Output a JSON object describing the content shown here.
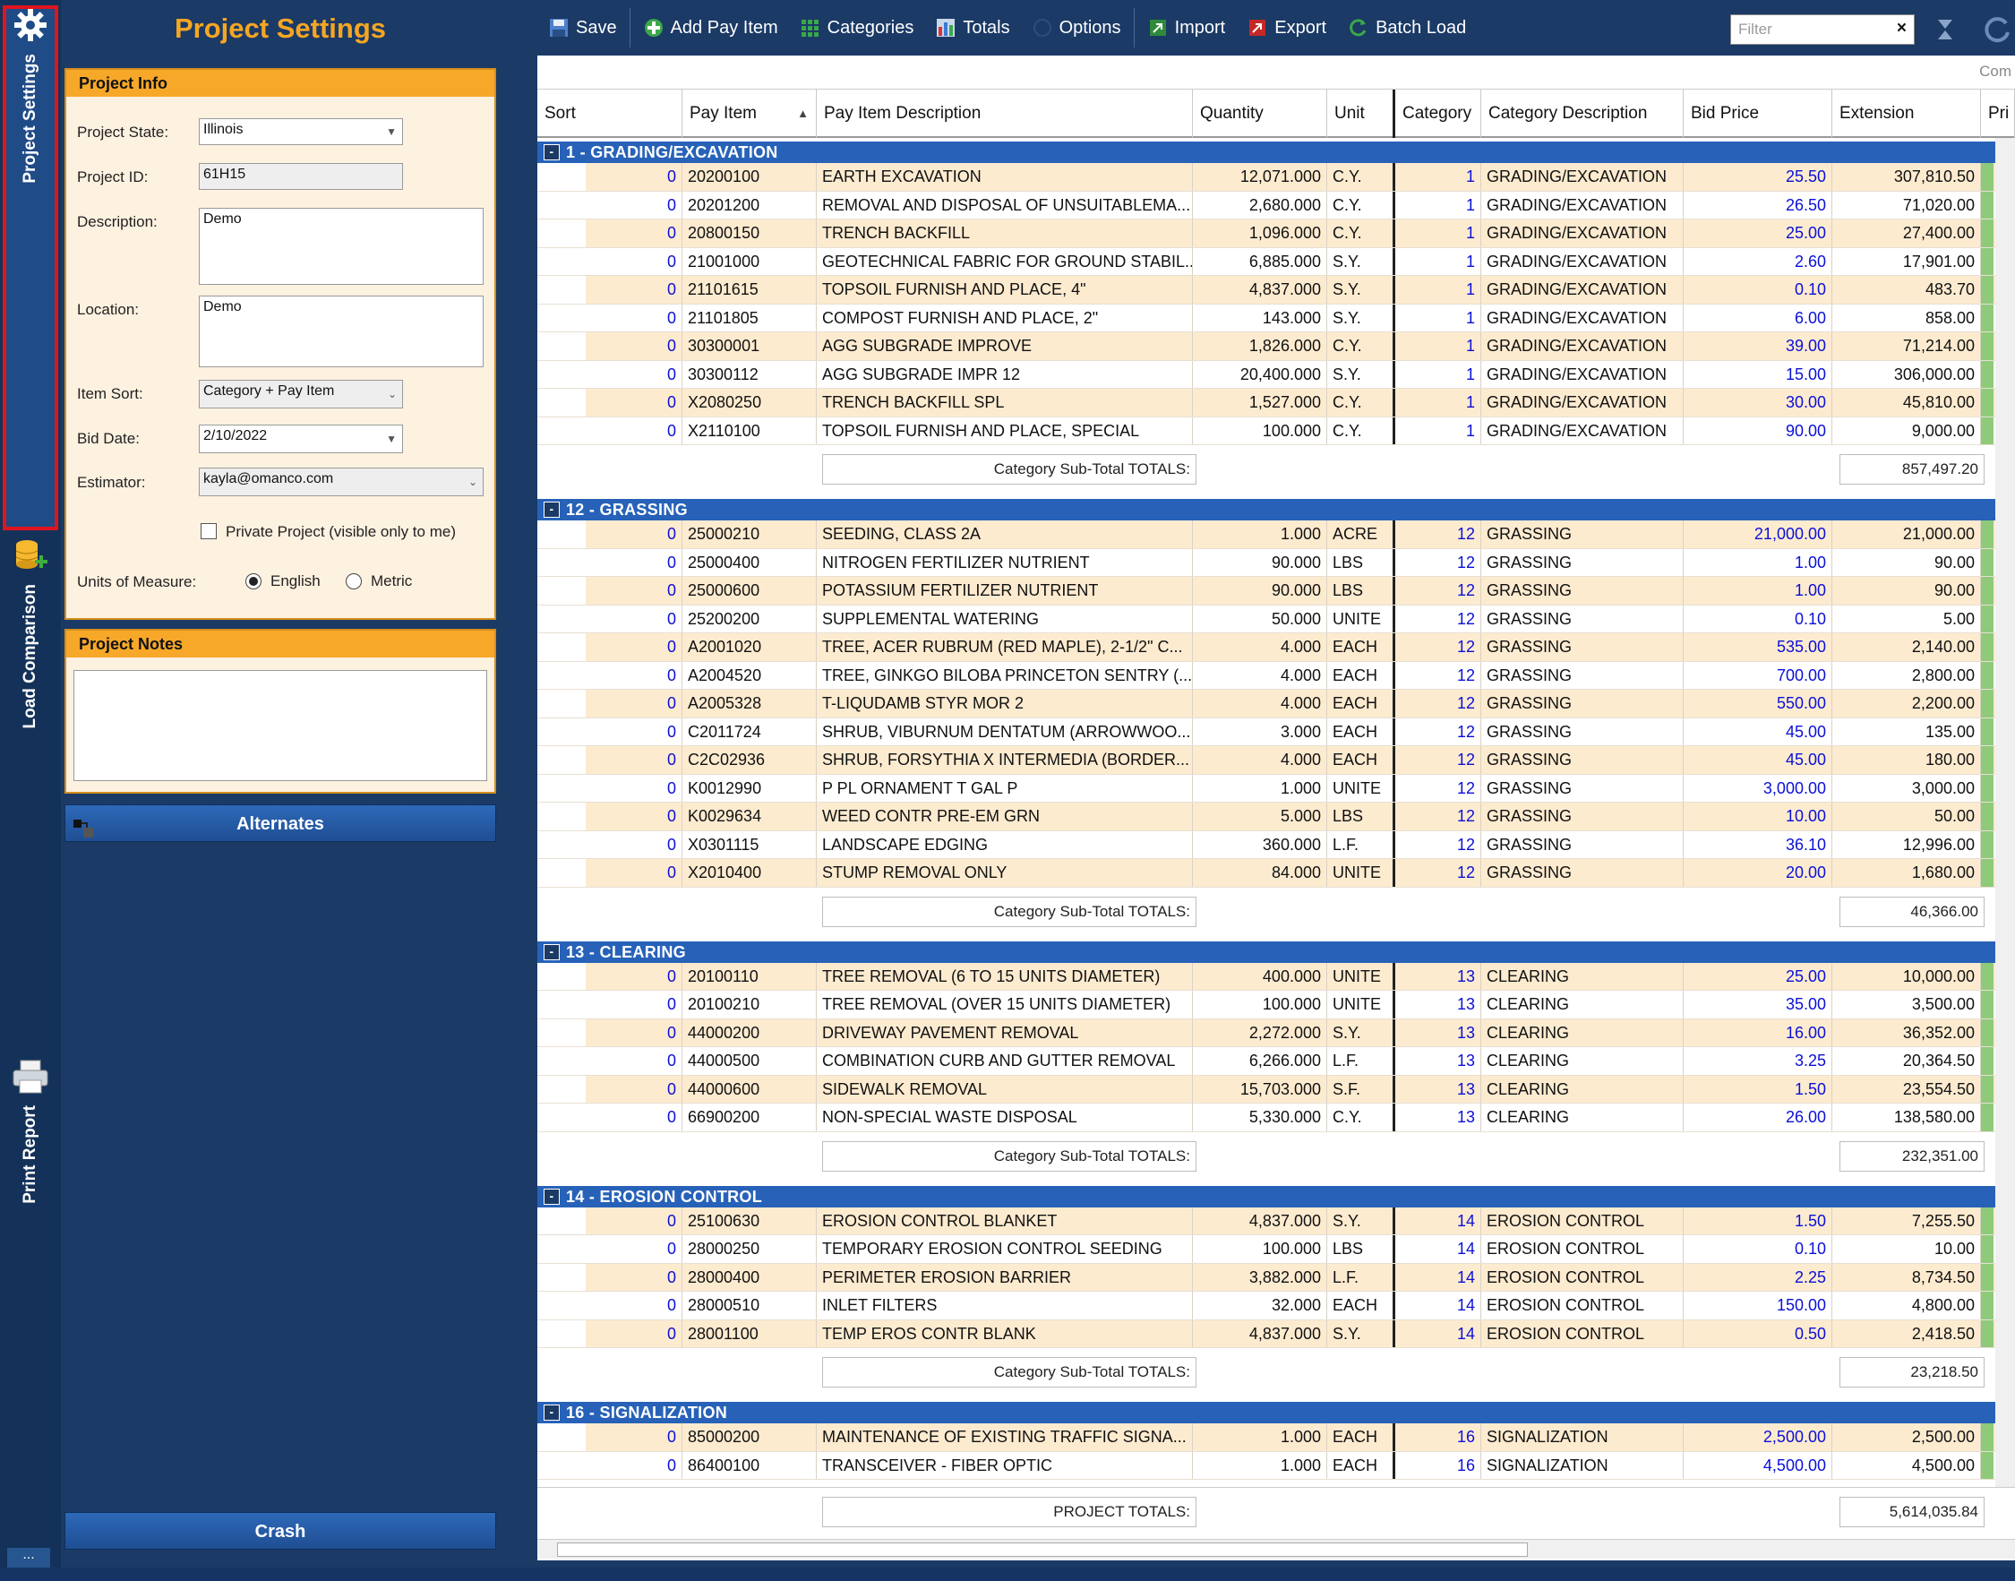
{
  "sidetabs": [
    {
      "label": "Project Settings",
      "icon": "gear-icon"
    },
    {
      "label": "Load Comparison",
      "icon": "database-add-icon"
    },
    {
      "label": "Print Report",
      "icon": "printer-icon"
    }
  ],
  "more_label": "...",
  "panel": {
    "title": "Project Settings",
    "info_header": "Project Info",
    "state_label": "Project State:",
    "state_value": "Illinois",
    "id_label": "Project ID:",
    "id_value": "61H15",
    "desc_label": "Description:",
    "desc_value": "Demo",
    "loc_label": "Location:",
    "loc_value": "Demo",
    "sort_label": "Item Sort:",
    "sort_value": "Category + Pay Item",
    "bid_label": "Bid Date:",
    "bid_value": "2/10/2022",
    "est_label": "Estimator:",
    "est_value": "kayla@omanco.com",
    "private_label": "Private Project (visible only to me)",
    "uom_label": "Units of Measure:",
    "uom_english": "English",
    "uom_metric": "Metric",
    "notes_header": "Project Notes",
    "alternates_label": "Alternates",
    "crash_label": "Crash"
  },
  "toolbar": {
    "save": "Save",
    "add": "Add Pay Item",
    "categories": "Categories",
    "totals": "Totals",
    "options": "Options",
    "import": "Import",
    "export": "Export",
    "batch": "Batch Load",
    "filter_placeholder": "Filter",
    "filter_clear": "×"
  },
  "grid": {
    "top_cut": "Com",
    "headers": {
      "sort": "Sort",
      "pay": "Pay Item",
      "desc": "Pay Item Description",
      "qty": "Quantity",
      "unit": "Unit",
      "cat": "Category",
      "cdesc": "Category Description",
      "bid": "Bid Price",
      "ext": "Extension",
      "pri": "Pri"
    },
    "subtotal_label": "Category Sub-Total TOTALS:",
    "project_total_label": "PROJECT TOTALS:",
    "project_total_value": "5,614,035.84",
    "groups": [
      {
        "title": "1 - GRADING/EXCAVATION",
        "subtotal": "857,497.20",
        "rows": [
          {
            "sort": "0",
            "pay": "20200100",
            "desc": "EARTH EXCAVATION",
            "qty": "12,071.000",
            "unit": "C.Y.",
            "cat": "1",
            "cdesc": "GRADING/EXCAVATION",
            "bid": "25.50",
            "ext": "307,810.50"
          },
          {
            "sort": "0",
            "pay": "20201200",
            "desc": "REMOVAL AND DISPOSAL OF UNSUITABLEMA...",
            "qty": "2,680.000",
            "unit": "C.Y.",
            "cat": "1",
            "cdesc": "GRADING/EXCAVATION",
            "bid": "26.50",
            "ext": "71,020.00"
          },
          {
            "sort": "0",
            "pay": "20800150",
            "desc": "TRENCH BACKFILL",
            "qty": "1,096.000",
            "unit": "C.Y.",
            "cat": "1",
            "cdesc": "GRADING/EXCAVATION",
            "bid": "25.00",
            "ext": "27,400.00"
          },
          {
            "sort": "0",
            "pay": "21001000",
            "desc": "GEOTECHNICAL FABRIC FOR GROUND STABIL...",
            "qty": "6,885.000",
            "unit": "S.Y.",
            "cat": "1",
            "cdesc": "GRADING/EXCAVATION",
            "bid": "2.60",
            "ext": "17,901.00"
          },
          {
            "sort": "0",
            "pay": "21101615",
            "desc": "TOPSOIL FURNISH AND PLACE, 4\"",
            "qty": "4,837.000",
            "unit": "S.Y.",
            "cat": "1",
            "cdesc": "GRADING/EXCAVATION",
            "bid": "0.10",
            "ext": "483.70"
          },
          {
            "sort": "0",
            "pay": "21101805",
            "desc": "COMPOST FURNISH AND PLACE, 2\"",
            "qty": "143.000",
            "unit": "S.Y.",
            "cat": "1",
            "cdesc": "GRADING/EXCAVATION",
            "bid": "6.00",
            "ext": "858.00"
          },
          {
            "sort": "0",
            "pay": "30300001",
            "desc": "AGG SUBGRADE IMPROVE",
            "qty": "1,826.000",
            "unit": "C.Y.",
            "cat": "1",
            "cdesc": "GRADING/EXCAVATION",
            "bid": "39.00",
            "ext": "71,214.00"
          },
          {
            "sort": "0",
            "pay": "30300112",
            "desc": "AGG SUBGRADE IMPR 12",
            "qty": "20,400.000",
            "unit": "S.Y.",
            "cat": "1",
            "cdesc": "GRADING/EXCAVATION",
            "bid": "15.00",
            "ext": "306,000.00"
          },
          {
            "sort": "0",
            "pay": "X2080250",
            "desc": "TRENCH BACKFILL SPL",
            "qty": "1,527.000",
            "unit": "C.Y.",
            "cat": "1",
            "cdesc": "GRADING/EXCAVATION",
            "bid": "30.00",
            "ext": "45,810.00"
          },
          {
            "sort": "0",
            "pay": "X2110100",
            "desc": "TOPSOIL FURNISH AND PLACE, SPECIAL",
            "qty": "100.000",
            "unit": "C.Y.",
            "cat": "1",
            "cdesc": "GRADING/EXCAVATION",
            "bid": "90.00",
            "ext": "9,000.00"
          }
        ]
      },
      {
        "title": "12 - GRASSING",
        "subtotal": "46,366.00",
        "rows": [
          {
            "sort": "0",
            "pay": "25000210",
            "desc": "SEEDING, CLASS 2A",
            "qty": "1.000",
            "unit": "ACRE",
            "cat": "12",
            "cdesc": "GRASSING",
            "bid": "21,000.00",
            "ext": "21,000.00"
          },
          {
            "sort": "0",
            "pay": "25000400",
            "desc": "NITROGEN FERTILIZER NUTRIENT",
            "qty": "90.000",
            "unit": "LBS",
            "cat": "12",
            "cdesc": "GRASSING",
            "bid": "1.00",
            "ext": "90.00"
          },
          {
            "sort": "0",
            "pay": "25000600",
            "desc": "POTASSIUM FERTILIZER NUTRIENT",
            "qty": "90.000",
            "unit": "LBS",
            "cat": "12",
            "cdesc": "GRASSING",
            "bid": "1.00",
            "ext": "90.00"
          },
          {
            "sort": "0",
            "pay": "25200200",
            "desc": "SUPPLEMENTAL WATERING",
            "qty": "50.000",
            "unit": "UNITE",
            "cat": "12",
            "cdesc": "GRASSING",
            "bid": "0.10",
            "ext": "5.00"
          },
          {
            "sort": "0",
            "pay": "A2001020",
            "desc": "TREE, ACER RUBRUM (RED MAPLE), 2-1/2\" C...",
            "qty": "4.000",
            "unit": "EACH",
            "cat": "12",
            "cdesc": "GRASSING",
            "bid": "535.00",
            "ext": "2,140.00"
          },
          {
            "sort": "0",
            "pay": "A2004520",
            "desc": "TREE, GINKGO BILOBA PRINCETON SENTRY (...",
            "qty": "4.000",
            "unit": "EACH",
            "cat": "12",
            "cdesc": "GRASSING",
            "bid": "700.00",
            "ext": "2,800.00"
          },
          {
            "sort": "0",
            "pay": "A2005328",
            "desc": "T-LIQUDAMB STYR MOR 2",
            "qty": "4.000",
            "unit": "EACH",
            "cat": "12",
            "cdesc": "GRASSING",
            "bid": "550.00",
            "ext": "2,200.00"
          },
          {
            "sort": "0",
            "pay": "C2011724",
            "desc": "SHRUB, VIBURNUM DENTATUM (ARROWWOO...",
            "qty": "3.000",
            "unit": "EACH",
            "cat": "12",
            "cdesc": "GRASSING",
            "bid": "45.00",
            "ext": "135.00"
          },
          {
            "sort": "0",
            "pay": "C2C02936",
            "desc": "SHRUB, FORSYTHIA X INTERMEDIA (BORDER...",
            "qty": "4.000",
            "unit": "EACH",
            "cat": "12",
            "cdesc": "GRASSING",
            "bid": "45.00",
            "ext": "180.00"
          },
          {
            "sort": "0",
            "pay": "K0012990",
            "desc": "P PL ORNAMENT T GAL P",
            "qty": "1.000",
            "unit": "UNITE",
            "cat": "12",
            "cdesc": "GRASSING",
            "bid": "3,000.00",
            "ext": "3,000.00"
          },
          {
            "sort": "0",
            "pay": "K0029634",
            "desc": "WEED CONTR PRE-EM GRN",
            "qty": "5.000",
            "unit": "LBS",
            "cat": "12",
            "cdesc": "GRASSING",
            "bid": "10.00",
            "ext": "50.00"
          },
          {
            "sort": "0",
            "pay": "X0301115",
            "desc": "LANDSCAPE EDGING",
            "qty": "360.000",
            "unit": "L.F.",
            "cat": "12",
            "cdesc": "GRASSING",
            "bid": "36.10",
            "ext": "12,996.00"
          },
          {
            "sort": "0",
            "pay": "X2010400",
            "desc": "STUMP REMOVAL ONLY",
            "qty": "84.000",
            "unit": "UNITE",
            "cat": "12",
            "cdesc": "GRASSING",
            "bid": "20.00",
            "ext": "1,680.00"
          }
        ]
      },
      {
        "title": "13 - CLEARING",
        "subtotal": "232,351.00",
        "rows": [
          {
            "sort": "0",
            "pay": "20100110",
            "desc": "TREE REMOVAL (6 TO 15 UNITS DIAMETER)",
            "qty": "400.000",
            "unit": "UNITE",
            "cat": "13",
            "cdesc": "CLEARING",
            "bid": "25.00",
            "ext": "10,000.00"
          },
          {
            "sort": "0",
            "pay": "20100210",
            "desc": "TREE REMOVAL (OVER 15 UNITS DIAMETER)",
            "qty": "100.000",
            "unit": "UNITE",
            "cat": "13",
            "cdesc": "CLEARING",
            "bid": "35.00",
            "ext": "3,500.00"
          },
          {
            "sort": "0",
            "pay": "44000200",
            "desc": "DRIVEWAY PAVEMENT REMOVAL",
            "qty": "2,272.000",
            "unit": "S.Y.",
            "cat": "13",
            "cdesc": "CLEARING",
            "bid": "16.00",
            "ext": "36,352.00"
          },
          {
            "sort": "0",
            "pay": "44000500",
            "desc": "COMBINATION CURB AND GUTTER REMOVAL",
            "qty": "6,266.000",
            "unit": "L.F.",
            "cat": "13",
            "cdesc": "CLEARING",
            "bid": "3.25",
            "ext": "20,364.50"
          },
          {
            "sort": "0",
            "pay": "44000600",
            "desc": "SIDEWALK REMOVAL",
            "qty": "15,703.000",
            "unit": "S.F.",
            "cat": "13",
            "cdesc": "CLEARING",
            "bid": "1.50",
            "ext": "23,554.50"
          },
          {
            "sort": "0",
            "pay": "66900200",
            "desc": "NON-SPECIAL WASTE DISPOSAL",
            "qty": "5,330.000",
            "unit": "C.Y.",
            "cat": "13",
            "cdesc": "CLEARING",
            "bid": "26.00",
            "ext": "138,580.00"
          }
        ]
      },
      {
        "title": "14 - EROSION CONTROL",
        "subtotal": "23,218.50",
        "rows": [
          {
            "sort": "0",
            "pay": "25100630",
            "desc": "EROSION CONTROL BLANKET",
            "qty": "4,837.000",
            "unit": "S.Y.",
            "cat": "14",
            "cdesc": "EROSION CONTROL",
            "bid": "1.50",
            "ext": "7,255.50"
          },
          {
            "sort": "0",
            "pay": "28000250",
            "desc": "TEMPORARY EROSION CONTROL SEEDING",
            "qty": "100.000",
            "unit": "LBS",
            "cat": "14",
            "cdesc": "EROSION CONTROL",
            "bid": "0.10",
            "ext": "10.00"
          },
          {
            "sort": "0",
            "pay": "28000400",
            "desc": "PERIMETER EROSION BARRIER",
            "qty": "3,882.000",
            "unit": "L.F.",
            "cat": "14",
            "cdesc": "EROSION CONTROL",
            "bid": "2.25",
            "ext": "8,734.50"
          },
          {
            "sort": "0",
            "pay": "28000510",
            "desc": "INLET FILTERS",
            "qty": "32.000",
            "unit": "EACH",
            "cat": "14",
            "cdesc": "EROSION CONTROL",
            "bid": "150.00",
            "ext": "4,800.00"
          },
          {
            "sort": "0",
            "pay": "28001100",
            "desc": "TEMP EROS CONTR BLANK",
            "qty": "4,837.000",
            "unit": "S.Y.",
            "cat": "14",
            "cdesc": "EROSION CONTROL",
            "bid": "0.50",
            "ext": "2,418.50"
          }
        ]
      },
      {
        "title": "16 - SIGNALIZATION",
        "subtotal": "",
        "rows": [
          {
            "sort": "0",
            "pay": "85000200",
            "desc": "MAINTENANCE OF EXISTING TRAFFIC SIGNA...",
            "qty": "1.000",
            "unit": "EACH",
            "cat": "16",
            "cdesc": "SIGNALIZATION",
            "bid": "2,500.00",
            "ext": "2,500.00"
          },
          {
            "sort": "0",
            "pay": "86400100",
            "desc": "TRANSCEIVER - FIBER OPTIC",
            "qty": "1.000",
            "unit": "EACH",
            "cat": "16",
            "cdesc": "SIGNALIZATION",
            "bid": "4,500.00",
            "ext": "4,500.00"
          }
        ]
      }
    ]
  }
}
